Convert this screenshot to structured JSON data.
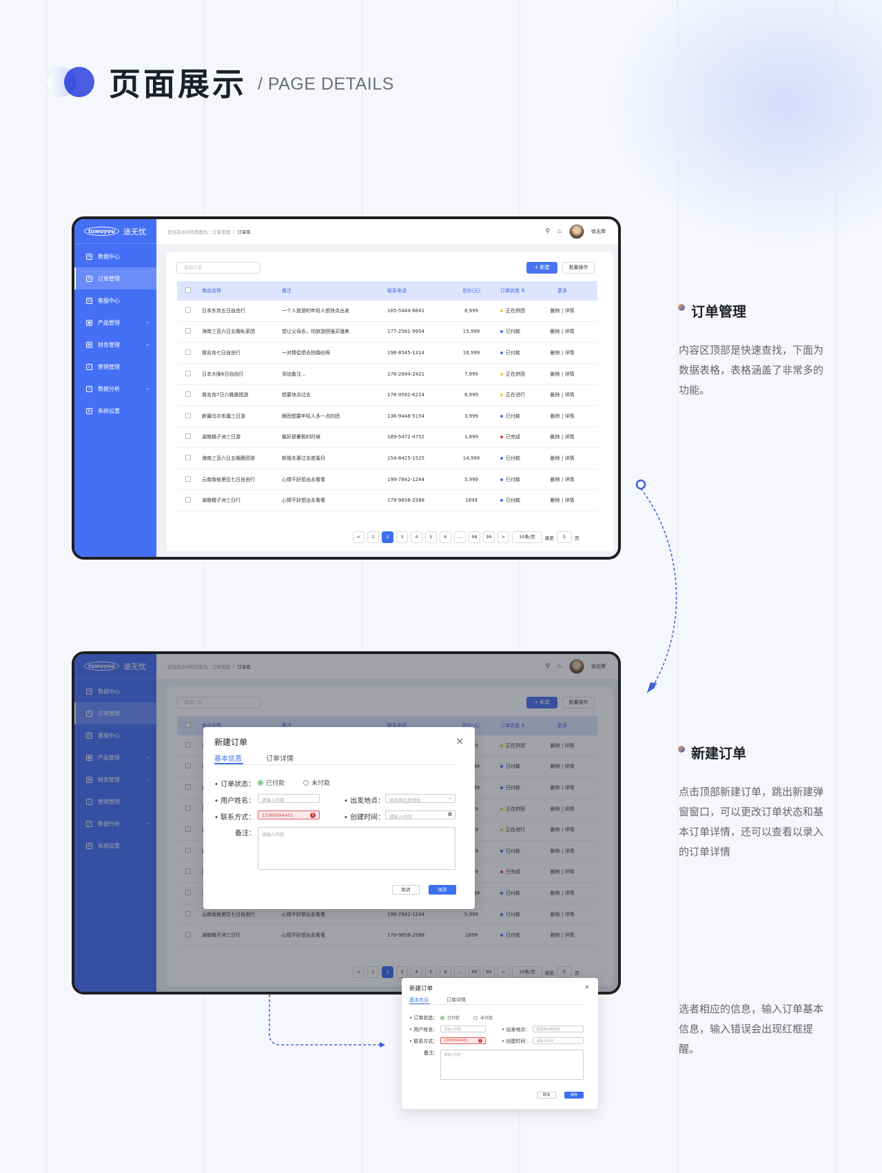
{
  "header": {
    "title": "页面展示",
    "subtitle": "/ PAGE DETAILS"
  },
  "app": {
    "brand_en": "tuwuyou",
    "brand_cn": "途无忧",
    "nav": [
      {
        "label": "数据中心",
        "icon": "gauge-icon",
        "chev": false
      },
      {
        "label": "订单管理",
        "icon": "edit-icon",
        "chev": false,
        "active": true
      },
      {
        "label": "客服中心",
        "icon": "headset-icon",
        "chev": false
      },
      {
        "label": "产品管理",
        "icon": "grid-icon",
        "chev": true
      },
      {
        "label": "财务管理",
        "icon": "ledger-icon",
        "chev": true
      },
      {
        "label": "营销管理",
        "icon": "check-circle-icon",
        "chev": false
      },
      {
        "label": "数据分析",
        "icon": "chart-icon",
        "chev": true
      },
      {
        "label": "系统设置",
        "icon": "gear-icon",
        "chev": false
      }
    ],
    "breadcrumb": {
      "prefix": "您当前访问的页面为：",
      "parent": "订单管理",
      "sep": "/",
      "current": "订单库"
    },
    "user": "徐志摩",
    "search_placeholder": "查询订单",
    "btn_new": "+ 新建",
    "btn_batch": "批量操作",
    "columns": [
      "商品名称",
      "备注",
      "联系电话",
      "总价(元)",
      "订单状态 ⇅",
      "更多"
    ],
    "rows": [
      {
        "name": "日本东京五日自由行",
        "note": "一个人旅游的年轻人想快点出发",
        "phone": "165-5444-6841",
        "price": "8,999",
        "status": "正在拼团",
        "color": "#f5c542",
        "more": "删除 | 详情"
      },
      {
        "name": "海南三亚六日五晚私家团",
        "note": "想让父母去，怕旅游团强买强卖",
        "phone": "177-2581-9954",
        "price": "15,999",
        "status": "已付款",
        "color": "#3d6ff0",
        "more": "删除 | 详情"
      },
      {
        "name": "普吉岛七日自由行",
        "note": "一对情侣想去拍婚纱照",
        "phone": "198-8545-1314",
        "price": "16,999",
        "status": "已付款",
        "color": "#3d6ff0",
        "more": "删除 | 详情"
      },
      {
        "name": "日本大阪6日自由行",
        "note": "添加备注...",
        "phone": "178-2694-2421",
        "price": "7,999",
        "status": "正在拼团",
        "color": "#f5c542",
        "more": "删除 | 详情"
      },
      {
        "name": "普吉岛7日六晚跟团游",
        "note": "想要快点过去",
        "phone": "176-9582-6214",
        "price": "8,999",
        "status": "正在进行",
        "color": "#f5c542",
        "more": "删除 | 详情"
      },
      {
        "name": "新疆乌尔禾魔三日游",
        "note": "跟团想要年轻人多一点的团",
        "phone": "136-9448-5154",
        "price": "3,999",
        "status": "已付款",
        "color": "#3d6ff0",
        "more": "删除 | 详情"
      },
      {
        "name": "湖南橘子洲三日游",
        "note": "最好是暑假的时候",
        "phone": "189-5472-4752",
        "price": "1,899",
        "status": "已完成",
        "color": "#e03b3b",
        "more": "删除 | 详情"
      },
      {
        "name": "海南三亚六日五晚跟团游",
        "note": "新婚夫妻过去度蜜月",
        "phone": "154-8425-1525",
        "price": "14,999",
        "status": "已付款",
        "color": "#3d6ff0",
        "more": "删除 | 详情"
      },
      {
        "name": "云南香格里拉七日自由行",
        "note": "心情不好想出去看看",
        "phone": "199-7842-1244",
        "price": "5,999",
        "status": "已付款",
        "color": "#3d6ff0",
        "more": "删除 | 详情"
      },
      {
        "name": "湖南橘子洲三日行",
        "note": "心情不好想出去看看",
        "phone": "178-9658-2588",
        "price": "1899",
        "status": "已付款",
        "color": "#3d6ff0",
        "more": "删除 | 详情"
      }
    ],
    "pager": {
      "prev": "<",
      "pages": [
        "1",
        "2",
        "3",
        "4",
        "5",
        "6",
        "...",
        "98",
        "99"
      ],
      "active": "2",
      "next": ">",
      "size": "10条/页",
      "jump": "跳至",
      "jump_val": "5",
      "unit": "页"
    }
  },
  "modal": {
    "title": "新建订单",
    "close": "×",
    "tab_basic": "基本信息",
    "tab_detail": "订单详情",
    "status_label": "• 订单状态：",
    "paid": "已付款",
    "unpaid": "未付款",
    "name_label": "• 用户姓名：",
    "name_ph": "请输入内容",
    "from_label": "• 出发地点：",
    "from_ph": "请选择出发地址",
    "phone_label": "• 联系方式：",
    "phone_val": "13365694451",
    "time_label": "• 创建时间：",
    "time_ph": "请输入时间",
    "note_label": "备注：",
    "note_ph": "请输入内容",
    "cancel": "取消",
    "save": "保存"
  },
  "sections": [
    {
      "title": "订单管理",
      "desc": "内容区顶部是快速查找，下面为数据表格，表格涵盖了非常多的功能。"
    },
    {
      "title": "新建订单",
      "desc": "点击顶部新建订单，跳出新建弹窗窗口，可以更改订单状态和基本订单详情，还可以查看以录入的订单详情"
    },
    {
      "desc": "选者相应的信息，输入订单基本信息，输入错误会出现红框提醒。"
    }
  ],
  "colors": {
    "accent": "#4570f5",
    "primary_btn": "#3d6ff0",
    "header_bg": "#dce5fd"
  }
}
